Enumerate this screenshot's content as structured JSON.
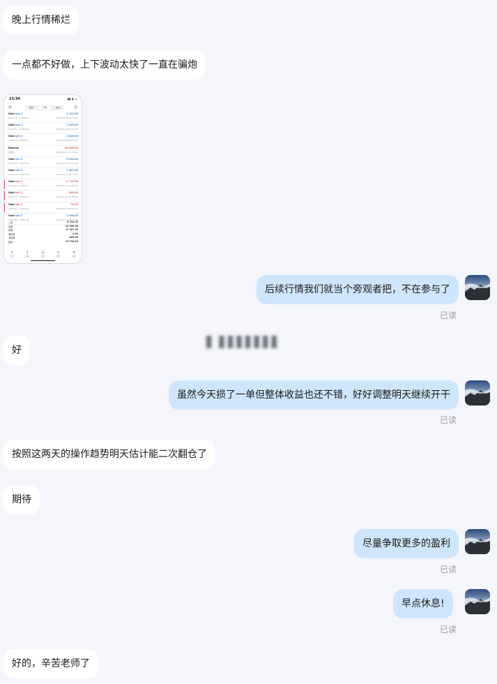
{
  "colors": {
    "background": "#f4f6fb",
    "incoming_bubble": "#ffffff",
    "outgoing_bubble": "#cfe5fb",
    "read_receipt": "#9a9ca3",
    "profit_blue": "#3d8bdc",
    "loss_red": "#e45b5b"
  },
  "messages": [
    {
      "side": "in",
      "text": "晚上行情稀烂"
    },
    {
      "side": "in",
      "text": "一点都不好做，上下波动太快了一直在骗炮"
    },
    {
      "side": "out",
      "text": "后续行情我们就当个旁观者把，不在参与了",
      "status": "已读"
    },
    {
      "side": "in",
      "text": "好"
    },
    {
      "side": "out",
      "text": "虽然今天损了一单但整体收益也还不错，好好调整明天继续开干",
      "status": "已读"
    },
    {
      "side": "in",
      "text": "按照这两天的操作趋势明天估计能二次翻仓了"
    },
    {
      "side": "in",
      "text": "期待"
    },
    {
      "side": "out",
      "text": "尽量争取更多的盈利",
      "status": "已读"
    },
    {
      "side": "out",
      "text": "早点休息!",
      "status": "已读"
    },
    {
      "side": "in",
      "text": "好的，辛苦老师了"
    }
  ],
  "blurred_label": "▋ ▋▋▋▋▋▋▋",
  "phone_screenshot": {
    "time": "23:34",
    "status_right": "▮▮ ◉ ▭",
    "header_left": "31",
    "segments": [
      "持仓",
      "订单",
      "成交"
    ],
    "active_segment": 0,
    "header_icon": "clock-icon",
    "rows": [
      {
        "symbol": "Gold",
        "action": "buy 2",
        "kind": "buy",
        "value": "1 152.00",
        "line2_left": "4395.17 → 4388.98",
        "line2_right": "2025.12.18 10:20:14"
      },
      {
        "symbol": "Gold",
        "action": "buy 2",
        "kind": "buy",
        "value": "3 295.00",
        "line2_left": "4378.49 → 4389.94",
        "line2_right": "2025.12.18 01:41:33"
      },
      {
        "symbol": "Gold",
        "action": "sell 2",
        "kind": "buy",
        "value": "2 846.00",
        "line2_left": "4386.75 → 4378.50",
        "line2_right": "2025.12.18 00:21:11"
      },
      {
        "symbol": "Balance",
        "action": "",
        "kind": "sell",
        "value": "-10 000.00",
        "line2_left": "充值01",
        "line2_right": "2025.12.17 11:54:44"
      },
      {
        "symbol": "Gold",
        "action": "sell 2",
        "kind": "buy",
        "value": "4 534.00",
        "line2_left": "4336.66 → 4313.80",
        "line2_right": "2025.12.17 16:11:35"
      },
      {
        "symbol": "Gold",
        "action": "sell 1",
        "kind": "buy",
        "value": "2 567.00",
        "line2_left": "4339.02 → 4313.38",
        "line2_right": "2025.12.17 10:11:54"
      },
      {
        "symbol": "Gold",
        "action": "sell 2",
        "kind": "sell",
        "value": "-1 712.00",
        "line2_left": "4318.45 → 4326.77",
        "line2_right": "2025.12.17 21:08:45",
        "mark": true
      },
      {
        "symbol": "Gold",
        "action": "sell 1",
        "kind": "sell",
        "value": "-390.00",
        "line2_left": "4322.27 → 4326.17",
        "line2_right": "2025.12.17 21:08:45",
        "mark": true
      },
      {
        "symbol": "Gold",
        "action": "sell 2",
        "kind": "sell",
        "value": "-78.00",
        "line2_left": "4299.90 → 4300.00",
        "line2_right": "2025.12.17 21:07:42",
        "mark": true
      },
      {
        "symbol": "Gold",
        "action": "sell 2",
        "kind": "buy",
        "value": "1 968.00",
        "line2_left": "4308.09 → 4304.78",
        "line2_right": "2025.12.17 20:37:27"
      }
    ],
    "summary": [
      {
        "label": "入金",
        "value": "N 332.00"
      },
      {
        "label": "出金",
        "value": "-10 000.00"
      },
      {
        "label": "利润",
        "value": "17 187.00"
      },
      {
        "label": "库存费",
        "value": "0.00"
      },
      {
        "label": "手续费",
        "value": "-800.00"
      },
      {
        "label": "结余",
        "value": "15 799.00"
      }
    ],
    "tabs": [
      {
        "label": "行情",
        "icon": "quotes-icon"
      },
      {
        "label": "图表",
        "icon": "chart-icon"
      },
      {
        "label": "交易",
        "icon": "trade-icon"
      },
      {
        "label": "历史",
        "icon": "history-icon"
      },
      {
        "label": "设置",
        "icon": "settings-icon"
      }
    ],
    "active_tab": 3
  }
}
